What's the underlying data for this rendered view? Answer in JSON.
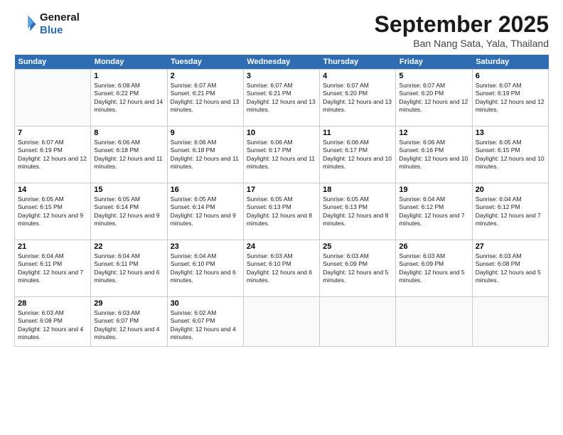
{
  "logo": {
    "line1": "General",
    "line2": "Blue"
  },
  "title": "September 2025",
  "location": "Ban Nang Sata, Yala, Thailand",
  "weekdays": [
    "Sunday",
    "Monday",
    "Tuesday",
    "Wednesday",
    "Thursday",
    "Friday",
    "Saturday"
  ],
  "weeks": [
    [
      {
        "day": "",
        "sunrise": "",
        "sunset": "",
        "daylight": ""
      },
      {
        "day": "1",
        "sunrise": "Sunrise: 6:08 AM",
        "sunset": "Sunset: 6:22 PM",
        "daylight": "Daylight: 12 hours and 14 minutes."
      },
      {
        "day": "2",
        "sunrise": "Sunrise: 6:07 AM",
        "sunset": "Sunset: 6:21 PM",
        "daylight": "Daylight: 12 hours and 13 minutes."
      },
      {
        "day": "3",
        "sunrise": "Sunrise: 6:07 AM",
        "sunset": "Sunset: 6:21 PM",
        "daylight": "Daylight: 12 hours and 13 minutes."
      },
      {
        "day": "4",
        "sunrise": "Sunrise: 6:07 AM",
        "sunset": "Sunset: 6:20 PM",
        "daylight": "Daylight: 12 hours and 13 minutes."
      },
      {
        "day": "5",
        "sunrise": "Sunrise: 6:07 AM",
        "sunset": "Sunset: 6:20 PM",
        "daylight": "Daylight: 12 hours and 12 minutes."
      },
      {
        "day": "6",
        "sunrise": "Sunrise: 6:07 AM",
        "sunset": "Sunset: 6:19 PM",
        "daylight": "Daylight: 12 hours and 12 minutes."
      }
    ],
    [
      {
        "day": "7",
        "sunrise": "Sunrise: 6:07 AM",
        "sunset": "Sunset: 6:19 PM",
        "daylight": "Daylight: 12 hours and 12 minutes."
      },
      {
        "day": "8",
        "sunrise": "Sunrise: 6:06 AM",
        "sunset": "Sunset: 6:18 PM",
        "daylight": "Daylight: 12 hours and 11 minutes."
      },
      {
        "day": "9",
        "sunrise": "Sunrise: 6:06 AM",
        "sunset": "Sunset: 6:18 PM",
        "daylight": "Daylight: 12 hours and 11 minutes."
      },
      {
        "day": "10",
        "sunrise": "Sunrise: 6:06 AM",
        "sunset": "Sunset: 6:17 PM",
        "daylight": "Daylight: 12 hours and 11 minutes."
      },
      {
        "day": "11",
        "sunrise": "Sunrise: 6:06 AM",
        "sunset": "Sunset: 6:17 PM",
        "daylight": "Daylight: 12 hours and 10 minutes."
      },
      {
        "day": "12",
        "sunrise": "Sunrise: 6:06 AM",
        "sunset": "Sunset: 6:16 PM",
        "daylight": "Daylight: 12 hours and 10 minutes."
      },
      {
        "day": "13",
        "sunrise": "Sunrise: 6:05 AM",
        "sunset": "Sunset: 6:15 PM",
        "daylight": "Daylight: 12 hours and 10 minutes."
      }
    ],
    [
      {
        "day": "14",
        "sunrise": "Sunrise: 6:05 AM",
        "sunset": "Sunset: 6:15 PM",
        "daylight": "Daylight: 12 hours and 9 minutes."
      },
      {
        "day": "15",
        "sunrise": "Sunrise: 6:05 AM",
        "sunset": "Sunset: 6:14 PM",
        "daylight": "Daylight: 12 hours and 9 minutes."
      },
      {
        "day": "16",
        "sunrise": "Sunrise: 6:05 AM",
        "sunset": "Sunset: 6:14 PM",
        "daylight": "Daylight: 12 hours and 9 minutes."
      },
      {
        "day": "17",
        "sunrise": "Sunrise: 6:05 AM",
        "sunset": "Sunset: 6:13 PM",
        "daylight": "Daylight: 12 hours and 8 minutes."
      },
      {
        "day": "18",
        "sunrise": "Sunrise: 6:05 AM",
        "sunset": "Sunset: 6:13 PM",
        "daylight": "Daylight: 12 hours and 8 minutes."
      },
      {
        "day": "19",
        "sunrise": "Sunrise: 6:04 AM",
        "sunset": "Sunset: 6:12 PM",
        "daylight": "Daylight: 12 hours and 7 minutes."
      },
      {
        "day": "20",
        "sunrise": "Sunrise: 6:04 AM",
        "sunset": "Sunset: 6:12 PM",
        "daylight": "Daylight: 12 hours and 7 minutes."
      }
    ],
    [
      {
        "day": "21",
        "sunrise": "Sunrise: 6:04 AM",
        "sunset": "Sunset: 6:11 PM",
        "daylight": "Daylight: 12 hours and 7 minutes."
      },
      {
        "day": "22",
        "sunrise": "Sunrise: 6:04 AM",
        "sunset": "Sunset: 6:11 PM",
        "daylight": "Daylight: 12 hours and 6 minutes."
      },
      {
        "day": "23",
        "sunrise": "Sunrise: 6:04 AM",
        "sunset": "Sunset: 6:10 PM",
        "daylight": "Daylight: 12 hours and 6 minutes."
      },
      {
        "day": "24",
        "sunrise": "Sunrise: 6:03 AM",
        "sunset": "Sunset: 6:10 PM",
        "daylight": "Daylight: 12 hours and 6 minutes."
      },
      {
        "day": "25",
        "sunrise": "Sunrise: 6:03 AM",
        "sunset": "Sunset: 6:09 PM",
        "daylight": "Daylight: 12 hours and 5 minutes."
      },
      {
        "day": "26",
        "sunrise": "Sunrise: 6:03 AM",
        "sunset": "Sunset: 6:09 PM",
        "daylight": "Daylight: 12 hours and 5 minutes."
      },
      {
        "day": "27",
        "sunrise": "Sunrise: 6:03 AM",
        "sunset": "Sunset: 6:08 PM",
        "daylight": "Daylight: 12 hours and 5 minutes."
      }
    ],
    [
      {
        "day": "28",
        "sunrise": "Sunrise: 6:03 AM",
        "sunset": "Sunset: 6:08 PM",
        "daylight": "Daylight: 12 hours and 4 minutes."
      },
      {
        "day": "29",
        "sunrise": "Sunrise: 6:03 AM",
        "sunset": "Sunset: 6:07 PM",
        "daylight": "Daylight: 12 hours and 4 minutes."
      },
      {
        "day": "30",
        "sunrise": "Sunrise: 6:02 AM",
        "sunset": "Sunset: 6:07 PM",
        "daylight": "Daylight: 12 hours and 4 minutes."
      },
      {
        "day": "",
        "sunrise": "",
        "sunset": "",
        "daylight": ""
      },
      {
        "day": "",
        "sunrise": "",
        "sunset": "",
        "daylight": ""
      },
      {
        "day": "",
        "sunrise": "",
        "sunset": "",
        "daylight": ""
      },
      {
        "day": "",
        "sunrise": "",
        "sunset": "",
        "daylight": ""
      }
    ]
  ]
}
